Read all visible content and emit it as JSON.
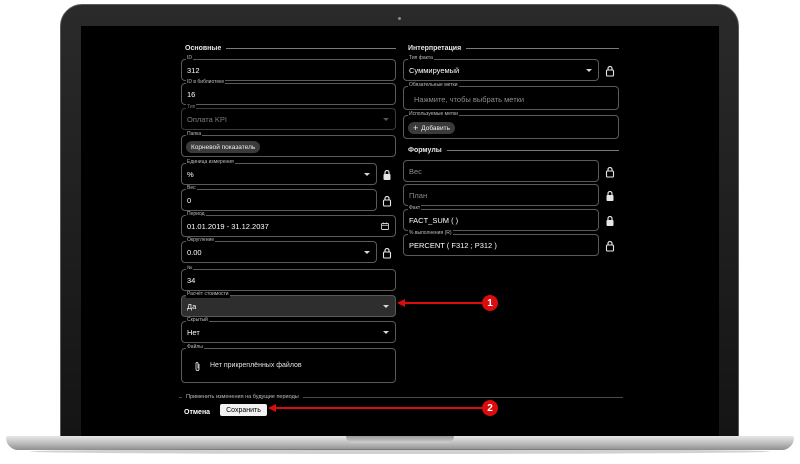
{
  "sections": {
    "main": "Основные",
    "interpretation": "Интерпретация",
    "formulas": "Формулы"
  },
  "fields": {
    "id": {
      "label": "ID",
      "value": "312"
    },
    "library_id": {
      "label": "ID в библиотеке",
      "value": "16"
    },
    "type": {
      "label": "Тип",
      "value": "Оплата KPI"
    },
    "folder": {
      "label": "Папка",
      "value": "Корневой показатель"
    },
    "unit": {
      "label": "Единица измерения",
      "value": "%"
    },
    "weight": {
      "label": "Вес",
      "value": "0"
    },
    "period": {
      "label": "Период",
      "value": "01.01.2019 - 31.12.2037"
    },
    "rounding": {
      "label": "Округление",
      "value": "0.00"
    },
    "number": {
      "label": "№",
      "value": "34"
    },
    "cost_calc": {
      "label": "Расчёт стоимости",
      "value": "Да"
    },
    "hidden": {
      "label": "Скрытый",
      "value": "Нет"
    },
    "files": {
      "label": "Файлы",
      "value": "Нет прикреплённых файлов"
    }
  },
  "interpretation": {
    "fact_type": {
      "label": "Тип факта",
      "value": "Суммируемый"
    },
    "required_tags": {
      "label": "Обязательные метки",
      "placeholder": "Нажмите, чтобы выбрать метки"
    },
    "used_tags": {
      "label": "Используемые метки",
      "add_label": "Добавить"
    }
  },
  "formulas": {
    "weight": {
      "placeholder": "Вес"
    },
    "plan": {
      "placeholder": "План"
    },
    "fact": {
      "label": "Факт",
      "value": "FACT_SUM ( )"
    },
    "percent": {
      "label": "% выполнения (R)",
      "value": "PERCENT ( F312 ; P312 )"
    }
  },
  "footer": {
    "apply_future": "Применить изменения на будущие периоды",
    "cancel_label": "Отмена",
    "save_label": "Сохранить"
  },
  "annotations": {
    "badge1": "1",
    "badge2": "2"
  },
  "colors": {
    "annotation": "#d90d0d",
    "background": "#000000"
  },
  "icons": [
    "lock-icon",
    "chevron-down-icon",
    "calendar-icon",
    "paperclip-icon",
    "plus-icon"
  ]
}
